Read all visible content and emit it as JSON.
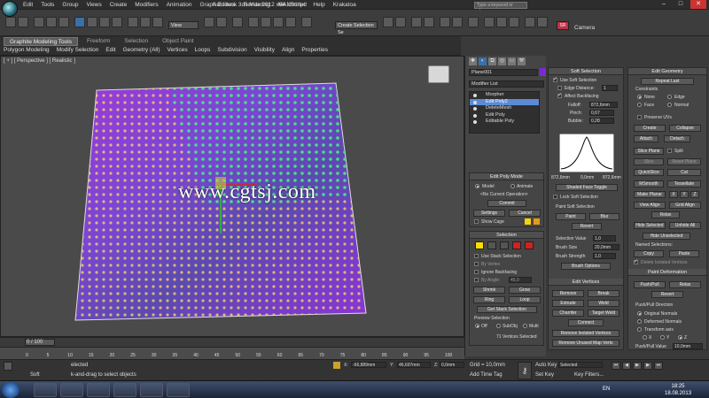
{
  "window": {
    "title": "Autodesk 3ds Max  2012 x64      Untitled",
    "search_placeholder": "Type a keyword or phrase",
    "menus": [
      "Edit",
      "Tools",
      "Group",
      "Views",
      "Create",
      "Modifiers",
      "Animation",
      "Graph Editors",
      "Rendering",
      "MAXScript",
      "Help",
      "Krakatoa"
    ]
  },
  "toolbar": {
    "view_dropdown": "View",
    "selection_set_dropdown": "Create Selection Se",
    "camera_label": "Camera"
  },
  "ribbon": {
    "tabs": [
      "Graphite Modeling Tools",
      "Freeform",
      "Selection",
      "Object Paint"
    ],
    "sub_items": [
      "Polygon Modeling",
      "Modify Selection",
      "Edit",
      "Geometry (All)",
      "Vertices",
      "Loops",
      "Subdivision",
      "Visibility",
      "Align",
      "Properties"
    ]
  },
  "viewport": {
    "label": "[ + ] [ Perspective ] [ Realistic ]",
    "watermark": "www.cgtsj.com"
  },
  "command_panel": {
    "object_name": "Plane001",
    "object_color": "#7a2bd0",
    "modifier_list": "Modifier List",
    "stack": [
      "Morpher",
      "Edit Poly2",
      "DeleteMesh",
      "Edit Poly",
      "Editable Poly"
    ],
    "selected_stack_index": 1,
    "edit_poly_mode": {
      "title": "Edit Poly Mode",
      "model": "Model",
      "animate": "Animate",
      "no_op": "<No Current Operation>",
      "commit": "Commit",
      "settings": "Settings",
      "cancel": "Cancel",
      "show_cage": "Show Cage"
    },
    "selection": {
      "title": "Selection",
      "use_stack": "Use Stack Selection",
      "by_vertex": "By Vertex",
      "ignore_backfacing": "Ignore Backfacing",
      "by_angle": "By Angle:",
      "by_angle_value": "45,0",
      "shrink": "Shrink",
      "grow": "Grow",
      "ring": "Ring",
      "loop": "Loop",
      "get_stack": "Get Stack Selection",
      "preview_title": "Preview Selection",
      "preview_off": "Off",
      "preview_subobj": "SubObj",
      "preview_multi": "Multi",
      "status": "71 Vertices Selected"
    }
  },
  "soft_selection": {
    "title": "Soft Selection",
    "use_soft": "Use Soft Selection",
    "edge_distance": "Edge Distance:",
    "edge_distance_value": "1",
    "affect_backfacing": "Affect Backfacing",
    "falloff_label": "Falloff:",
    "falloff_value": "872,6mm",
    "pinch_label": "Pinch:",
    "pinch_value": "0,67",
    "bubble_label": "Bubble:",
    "bubble_value": "0,28",
    "curve_left": "872,6mm",
    "curve_mid": "0,0mm",
    "curve_right": "872,6mm",
    "shaded_face_toggle": "Shaded Face Toggle",
    "lock_soft": "Lock Soft Selection",
    "paint_title": "Paint Soft Selection",
    "paint": "Paint",
    "blur": "Blur",
    "revert": "Revert",
    "selection_value_label": "Selection Value",
    "selection_value": "1,0",
    "brush_size_label": "Brush Size",
    "brush_size": "20,0mm",
    "brush_strength_label": "Brush Strength",
    "brush_strength": "1,0",
    "brush_options": "Brush Options",
    "edit_vertices_title": "Edit Vertices",
    "remove": "Remove",
    "break": "Break",
    "extrude": "Extrude",
    "weld": "Weld",
    "chamfer": "Chamfer",
    "target_weld": "Target Weld",
    "connect": "Connect",
    "remove_isolated": "Remove Isolated Vertices",
    "remove_unused_map": "Remove Unused Map Verts"
  },
  "edit_geometry": {
    "title": "Edit Geometry",
    "repeat_last": "Repeat Last",
    "constraints": "Constraints",
    "none": "None",
    "edge": "Edge",
    "face": "Face",
    "normal": "Normal",
    "preserve_uvs": "Preserve UVs",
    "create": "Create",
    "collapse": "Collapse",
    "attach": "Attach",
    "detach": "Detach",
    "slice_plane": "Slice Plane",
    "split": "Split",
    "slice": "Slice",
    "reset_plane": "Reset Plane",
    "quickslice": "QuickSlice",
    "cut": "Cut",
    "msmooth": "MSmooth",
    "tessellate": "Tessellate",
    "make_planar": "Make Planar",
    "x": "X",
    "y": "Y",
    "z": "Z",
    "view_align": "View Align",
    "grid_align": "Grid Align",
    "relax": "Relax",
    "hide_selected": "Hide Selected",
    "unhide_all": "Unhide All",
    "hide_unselected": "Hide Unselected",
    "named_selections": "Named Selections:",
    "copy": "Copy",
    "paste": "Paste",
    "delete_isolated": "Delete Isolated Vertices",
    "paint_deformation": "Paint Deformation",
    "push_pull": "Push/Pull",
    "relax2": "Relax",
    "revert": "Revert",
    "push_pull_direction": "Push/Pull Direction",
    "original_normals": "Original Normals",
    "deformed_normals": "Deformed Normals",
    "transform_axis": "Transform axis",
    "ax_x": "X",
    "ax_y": "Y",
    "ax_z": "Z",
    "push_pull_value_label": "Push/Pull Value",
    "push_pull_value": "10,0mm"
  },
  "timeline": {
    "frame": "0 / 100",
    "ticks": [
      "0",
      "5",
      "10",
      "15",
      "20",
      "25",
      "30",
      "35",
      "40",
      "45",
      "50",
      "55",
      "60",
      "65",
      "70",
      "75",
      "80",
      "85",
      "90",
      "95",
      "100"
    ]
  },
  "status": {
    "selected_text": "elected",
    "prompt_text": "k-and-drag to select objects",
    "x_value": "-66,889mm",
    "y_value": "46,697mm",
    "z_value": "0,0mm",
    "grid": "Grid = 10,0mm",
    "add_time_tag": "Add Time Tag",
    "auto_key": "Auto Key",
    "selected_dd": "Selected",
    "set_key": "Set Key",
    "key_filters": "Key Filters...",
    "soft_label": "Soft"
  },
  "taskbar": {
    "lang": "EN",
    "time": "18:25",
    "date": "18.08.2013"
  }
}
